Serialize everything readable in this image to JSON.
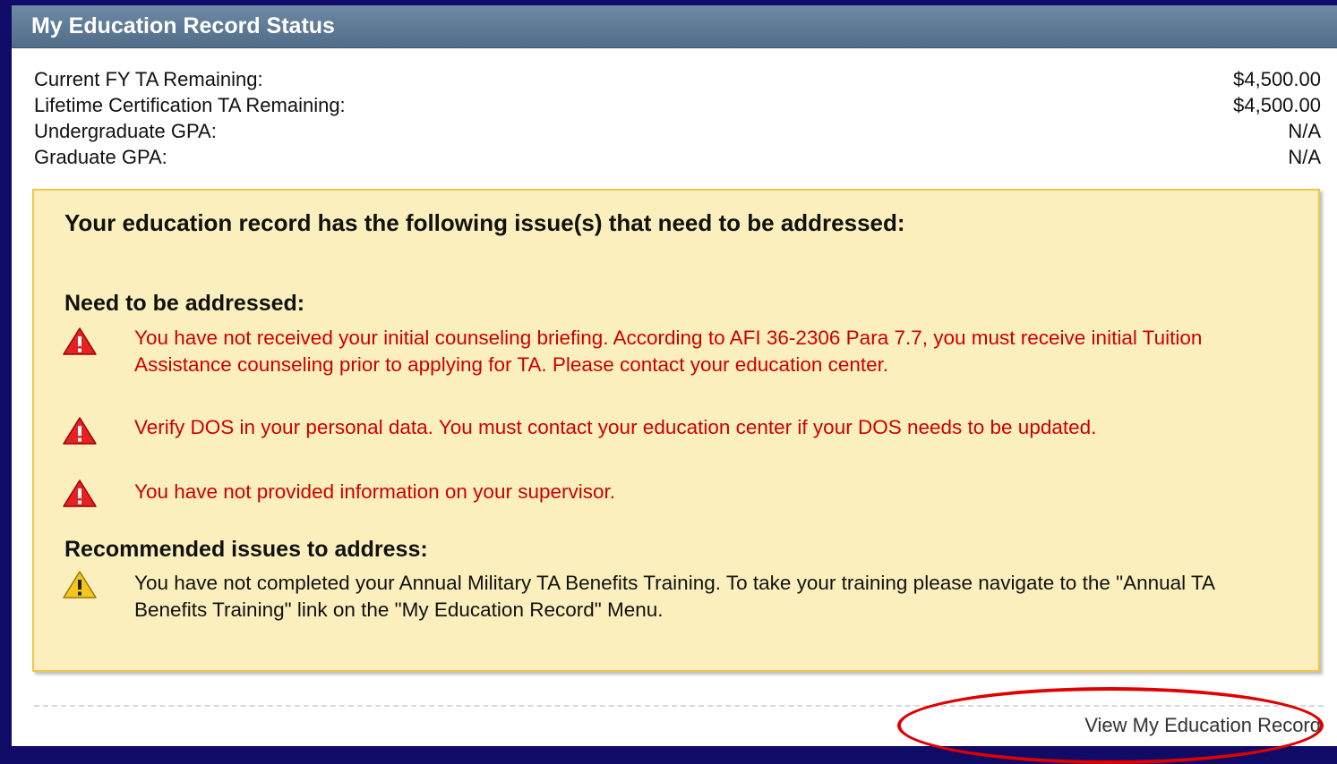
{
  "header": {
    "title": "My Education Record Status"
  },
  "stats": [
    {
      "label": "Current FY TA Remaining:",
      "value": "$4,500.00"
    },
    {
      "label": "Lifetime Certification TA Remaining:",
      "value": "$4,500.00"
    },
    {
      "label": "Undergraduate GPA:",
      "value": "N/A"
    },
    {
      "label": "Graduate GPA:",
      "value": "N/A"
    }
  ],
  "notice": {
    "title": "Your education record has the following issue(s) that need to be addressed:",
    "need_title": "Need to be addressed:",
    "need_items": [
      "You have not received your initial counseling briefing. According to AFI 36-2306 Para 7.7, you must receive initial Tuition Assistance counseling prior to applying for TA. Please contact your education center.",
      "Verify DOS in your personal data. You must contact your education center if your DOS needs to be updated.",
      "You have not provided information on your supervisor."
    ],
    "rec_title": "Recommended issues to address:",
    "rec_items": [
      "You have not completed your Annual Military TA Benefits Training. To take your training please navigate to the \"Annual TA Benefits Training\" link on the \"My Education Record\" Menu."
    ]
  },
  "link": {
    "label": "View My Education Record"
  },
  "icons": {
    "error": "error-triangle-icon",
    "warning": "warning-triangle-icon"
  },
  "colors": {
    "background": "#0f0b66",
    "header": "#5a7693",
    "notice_bg": "#fbf0bd",
    "error_text": "#cc0000",
    "highlight": "#e00000"
  }
}
